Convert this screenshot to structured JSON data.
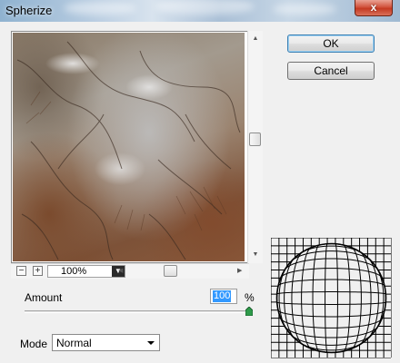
{
  "window": {
    "title": "Spherize",
    "close_glyph": "x"
  },
  "buttons": {
    "ok_label": "OK",
    "cancel_label": "Cancel"
  },
  "zoom": {
    "minus_glyph": "−",
    "plus_glyph": "+",
    "value": "100%",
    "dropdown_glyph": "▼"
  },
  "amount": {
    "label": "Amount",
    "value": "100",
    "unit": "%",
    "slider_fraction": 1.0
  },
  "mode": {
    "label": "Mode",
    "value": "Normal"
  },
  "icons": {
    "scroll_up": "▲",
    "scroll_down": "▼",
    "scroll_left": "◀",
    "scroll_right": "▶"
  }
}
